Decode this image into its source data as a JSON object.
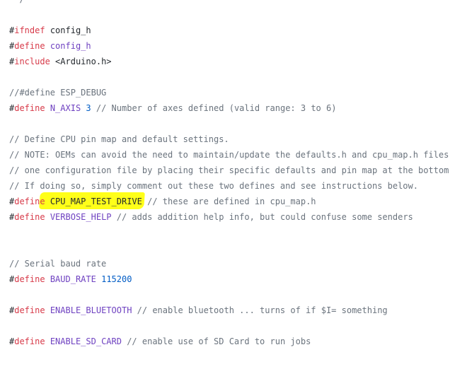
{
  "highlight_color": "#ffff00",
  "colors": {
    "keyword": "#d73a49",
    "macro": "#6f42c1",
    "number": "#005cc5",
    "comment": "#6a737d",
    "text": "#24292e"
  },
  "lines": [
    [
      {
        "t": "com",
        "v": " */"
      }
    ],
    [],
    [
      {
        "t": "hash",
        "v": "#"
      },
      {
        "t": "kw",
        "v": "ifndef"
      },
      {
        "t": "plain",
        "v": " config_h"
      }
    ],
    [
      {
        "t": "hash",
        "v": "#"
      },
      {
        "t": "kw",
        "v": "define"
      },
      {
        "t": "plain",
        "v": " "
      },
      {
        "t": "macro",
        "v": "config_h"
      }
    ],
    [
      {
        "t": "hash",
        "v": "#"
      },
      {
        "t": "kw",
        "v": "include"
      },
      {
        "t": "plain",
        "v": " "
      },
      {
        "t": "str",
        "v": "<Arduino.h>"
      }
    ],
    [],
    [
      {
        "t": "com",
        "v": "//#define ESP_DEBUG"
      }
    ],
    [
      {
        "t": "hash",
        "v": "#"
      },
      {
        "t": "kw",
        "v": "define"
      },
      {
        "t": "plain",
        "v": " "
      },
      {
        "t": "macro",
        "v": "N_AXIS"
      },
      {
        "t": "plain",
        "v": " "
      },
      {
        "t": "num",
        "v": "3"
      },
      {
        "t": "com",
        "v": " // Number of axes defined (valid range: 3 to 6)"
      }
    ],
    [],
    [
      {
        "t": "com",
        "v": "// Define CPU pin map and default settings."
      }
    ],
    [
      {
        "t": "com",
        "v": "// NOTE: OEMs can avoid the need to maintain/update the defaults.h and cpu_map.h files"
      }
    ],
    [
      {
        "t": "com",
        "v": "// one configuration file by placing their specific defaults and pin map at the bottom"
      }
    ],
    [
      {
        "t": "com",
        "v": "// If doing so, simply comment out these two defines and see instructions below."
      }
    ],
    [
      {
        "t": "hash",
        "v": "#"
      },
      {
        "t": "kw",
        "v": "define"
      },
      {
        "t": "plain",
        "v": " "
      },
      {
        "t": "plain",
        "v": "CPU_MAP_TEST_DRIVE"
      },
      {
        "t": "com",
        "v": " // these are defined in cpu_map.h"
      }
    ],
    [
      {
        "t": "hash",
        "v": "#"
      },
      {
        "t": "kw",
        "v": "define"
      },
      {
        "t": "plain",
        "v": " "
      },
      {
        "t": "macro",
        "v": "VERBOSE_HELP"
      },
      {
        "t": "com",
        "v": " // adds addition help info, but could confuse some senders"
      }
    ],
    [],
    [],
    [
      {
        "t": "com",
        "v": "// Serial baud rate"
      }
    ],
    [
      {
        "t": "hash",
        "v": "#"
      },
      {
        "t": "kw",
        "v": "define"
      },
      {
        "t": "plain",
        "v": " "
      },
      {
        "t": "macro",
        "v": "BAUD_RATE"
      },
      {
        "t": "plain",
        "v": " "
      },
      {
        "t": "num",
        "v": "115200"
      }
    ],
    [],
    [
      {
        "t": "hash",
        "v": "#"
      },
      {
        "t": "kw",
        "v": "define"
      },
      {
        "t": "plain",
        "v": " "
      },
      {
        "t": "macro",
        "v": "ENABLE_BLUETOOTH"
      },
      {
        "t": "com",
        "v": " // enable bluetooth ... turns of if $I= something"
      }
    ],
    [],
    [
      {
        "t": "hash",
        "v": "#"
      },
      {
        "t": "kw",
        "v": "define"
      },
      {
        "t": "plain",
        "v": " "
      },
      {
        "t": "macro",
        "v": "ENABLE_SD_CARD"
      },
      {
        "t": "com",
        "v": " // enable use of SD Card to run jobs"
      }
    ],
    []
  ]
}
